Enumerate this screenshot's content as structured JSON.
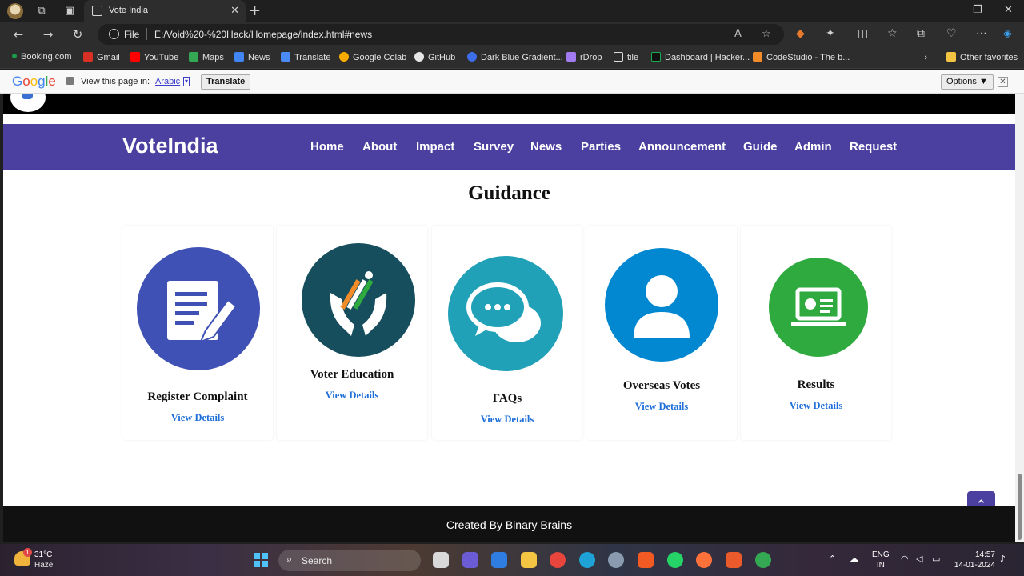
{
  "browser": {
    "tab_title": "Vote India",
    "url_scheme": "File",
    "url": "E:/Void%20-%20Hack/Homepage/index.html#news",
    "bookmarks": [
      "Booking.com",
      "Gmail",
      "YouTube",
      "Maps",
      "News",
      "Translate",
      "Google Colab",
      "GitHub",
      "Dark Blue Gradient...",
      "rDrop",
      "tile",
      "Dashboard | Hacker...",
      "CodeStudio - The b..."
    ],
    "other_favorites": "Other favorites"
  },
  "translate_bar": {
    "logo": "Google",
    "prompt": "View this page in:",
    "language": "Arabic",
    "translate_button": "Translate",
    "options_button": "Options ▼"
  },
  "site": {
    "brand": "VoteIndia",
    "nav": [
      "Home",
      "About",
      "Impact",
      "Survey",
      "News",
      "Parties",
      "Announcement",
      "Guide",
      "Admin",
      "Request"
    ],
    "section_title": "Guidance",
    "cards": [
      {
        "title": "Register Complaint",
        "link": "View Details",
        "icon": "document-pen-icon",
        "color": "#3f51b5"
      },
      {
        "title": "Voter Education",
        "link": "View Details",
        "icon": "hands-ballot-icon",
        "color": "#174e5e"
      },
      {
        "title": "FAQs",
        "link": "View Details",
        "icon": "chat-bubbles-icon",
        "color": "#21a1b8"
      },
      {
        "title": "Overseas Votes",
        "link": "View Details",
        "icon": "person-icon",
        "color": "#0288d1"
      },
      {
        "title": "Results",
        "link": "View Details",
        "icon": "monitor-chart-icon",
        "color": "#2eaa3f"
      }
    ],
    "footer": "Created By Binary Brains",
    "brand_color": "#4b3fa0"
  },
  "taskbar": {
    "temperature": "31°C",
    "weather": "Haze",
    "search": "Search",
    "lang_line1": "ENG",
    "lang_line2": "IN",
    "time": "14:57",
    "date": "14-01-2024"
  }
}
